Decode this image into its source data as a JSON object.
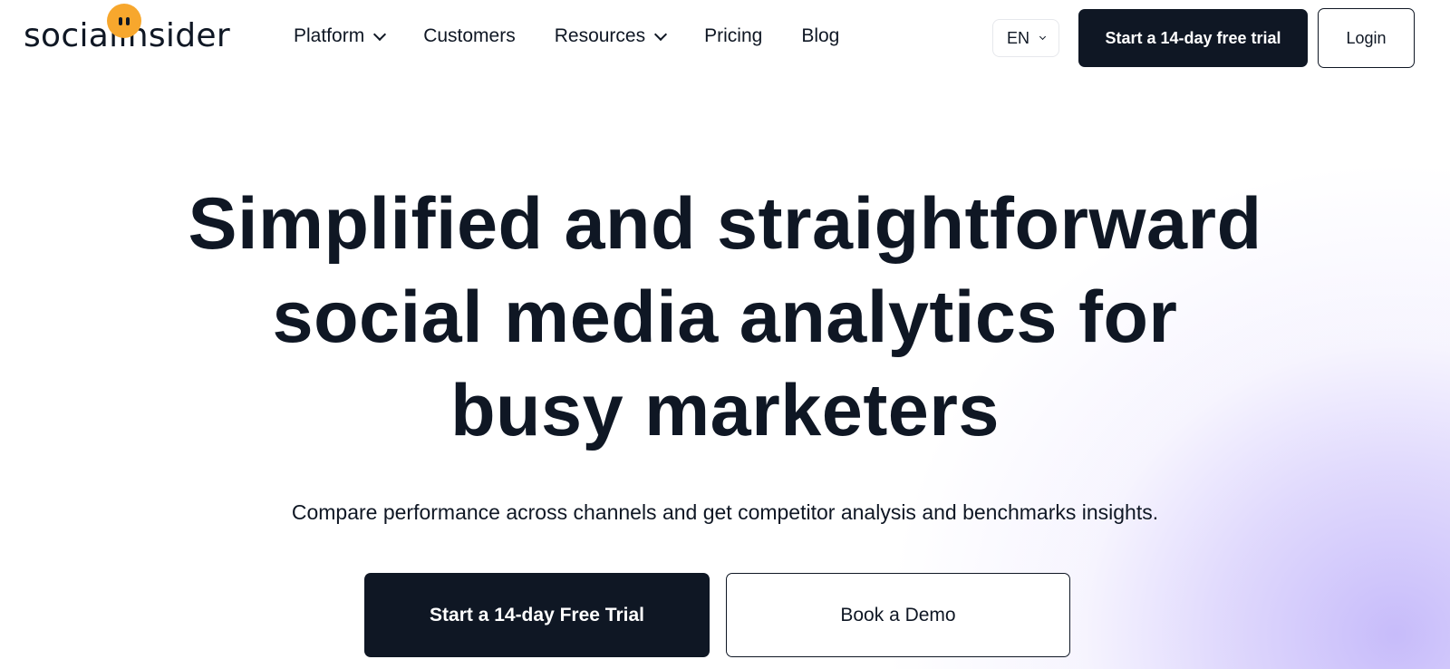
{
  "header": {
    "logo_text": "socialinsider",
    "nav": [
      {
        "label": "Platform",
        "has_dropdown": true
      },
      {
        "label": "Customers",
        "has_dropdown": false
      },
      {
        "label": "Resources",
        "has_dropdown": true
      },
      {
        "label": "Pricing",
        "has_dropdown": false
      },
      {
        "label": "Blog",
        "has_dropdown": false
      }
    ],
    "language": "EN",
    "trial_button": "Start a 14-day free trial",
    "login_button": "Login"
  },
  "hero": {
    "title_lines": [
      "Simplified and straightforward",
      "social media analytics for",
      "busy marketers"
    ],
    "subtitle": "Compare performance across channels and get competitor analysis and benchmarks insights.",
    "primary_button": "Start a 14-day Free Trial",
    "secondary_button": "Book a Demo"
  },
  "colors": {
    "ink": "#0f1724",
    "logo_accent": "#f7a72d",
    "glow": "#c4b8fa"
  },
  "icons": {
    "logo_mark": "smiley-dot-icon",
    "nav_dropdown": "chevron-down-icon"
  }
}
